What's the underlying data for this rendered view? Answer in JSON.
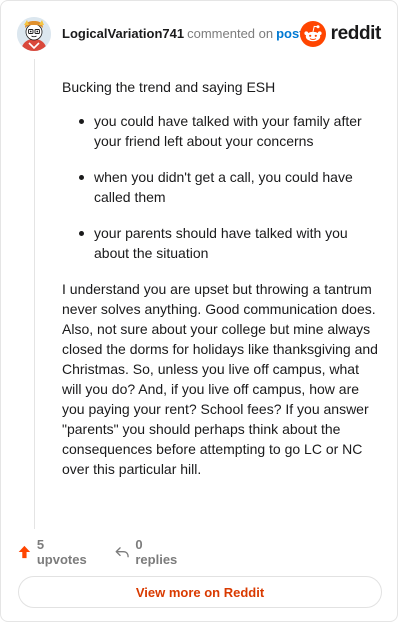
{
  "header": {
    "username": "LogicalVariation741",
    "action": "commented on",
    "post_link": "post",
    "brand": "reddit"
  },
  "comment": {
    "intro": "Bucking the trend and saying ESH",
    "bullets": [
      "you could have talked with your family after your friend left about your concerns",
      "when you didn't get a call, you could have called them",
      "your parents should have talked with you about the situation"
    ],
    "body": "I understand you are upset but throwing a tantrum never solves anything. Good communication does. Also, not sure about your college but mine always closed the dorms for holidays like thanksgiving and Christmas. So, unless you live off campus, what will you do? And, if you live off campus, how are you paying your rent? School fees? If you answer \"parents\" you should perhaps think about the consequences before attempting to go LC or NC over this particular hill."
  },
  "footer": {
    "upvotes": "5 upvotes",
    "replies": "0 replies"
  },
  "view_button": "View more on Reddit",
  "icons": {
    "avatar": "snoo-avatar-icon",
    "brand": "reddit-logo-icon",
    "upvote": "upvote-arrow-icon",
    "reply": "reply-arrow-icon"
  },
  "colors": {
    "brand_orange": "#ff4500",
    "link_blue": "#0079d3",
    "button_text": "#d93a00",
    "muted": "#7c7c7c"
  }
}
